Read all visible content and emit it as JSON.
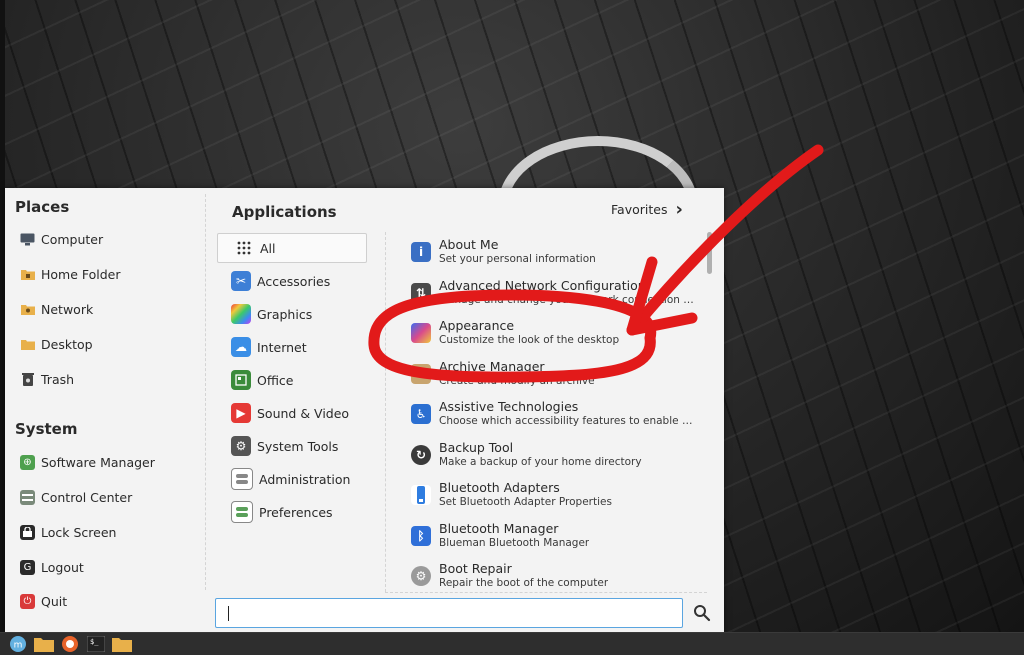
{
  "places": {
    "title": "Places",
    "items": [
      {
        "label": "Computer",
        "icon": "computer-icon"
      },
      {
        "label": "Home Folder",
        "icon": "home-folder-icon"
      },
      {
        "label": "Network",
        "icon": "network-folder-icon"
      },
      {
        "label": "Desktop",
        "icon": "desktop-folder-icon"
      },
      {
        "label": "Trash",
        "icon": "trash-icon"
      }
    ]
  },
  "system": {
    "title": "System",
    "items": [
      {
        "label": "Software Manager",
        "icon": "software-manager-icon"
      },
      {
        "label": "Control Center",
        "icon": "control-center-icon"
      },
      {
        "label": "Lock Screen",
        "icon": "lock-screen-icon"
      },
      {
        "label": "Logout",
        "icon": "logout-icon"
      },
      {
        "label": "Quit",
        "icon": "quit-icon"
      }
    ]
  },
  "applications": {
    "title": "Applications",
    "favorites_label": "Favorites",
    "categories": [
      {
        "label": "All",
        "icon": "grid-icon",
        "color": "#ffffff"
      },
      {
        "label": "Accessories",
        "icon": "scissors-icon",
        "color": "#3d7fd6"
      },
      {
        "label": "Graphics",
        "icon": "palette-icon",
        "color": "#c945c9"
      },
      {
        "label": "Internet",
        "icon": "cloud-icon",
        "color": "#3a8ee6"
      },
      {
        "label": "Office",
        "icon": "document-icon",
        "color": "#3b8b3b"
      },
      {
        "label": "Sound & Video",
        "icon": "play-icon",
        "color": "#e53935"
      },
      {
        "label": "System Tools",
        "icon": "gear-icon",
        "color": "#555555"
      },
      {
        "label": "Administration",
        "icon": "toggle-icon",
        "color": "#888888"
      },
      {
        "label": "Preferences",
        "icon": "toggle-icon",
        "color": "#5aa05a"
      }
    ],
    "apps": [
      {
        "name": "About Me",
        "description": "Set your personal information",
        "icon": "info-icon",
        "color": "#3a6fc4"
      },
      {
        "name": "Advanced Network Configuration",
        "description": "Manage and change your network connection sett...",
        "icon": "network-config-icon",
        "color": "#4a4a4a"
      },
      {
        "name": "Appearance",
        "description": "Customize the look of the desktop",
        "icon": "appearance-icon",
        "color": "#d94a8c"
      },
      {
        "name": "Archive Manager",
        "description": "Create and modify an archive",
        "icon": "archive-icon",
        "color": "#c8a46e"
      },
      {
        "name": "Assistive Technologies",
        "description": "Choose which accessibility features to enable whe...",
        "icon": "accessibility-icon",
        "color": "#2b6fd1"
      },
      {
        "name": "Backup Tool",
        "description": "Make a backup of your home directory",
        "icon": "backup-icon",
        "color": "#3a3a3a"
      },
      {
        "name": "Bluetooth Adapters",
        "description": "Set Bluetooth Adapter Properties",
        "icon": "bluetooth-adapter-icon",
        "color": "#2f7de0"
      },
      {
        "name": "Bluetooth Manager",
        "description": "Blueman Bluetooth Manager",
        "icon": "bluetooth-icon",
        "color": "#2f6fd8"
      },
      {
        "name": "Boot Repair",
        "description": "Repair the boot of the computer",
        "icon": "boot-repair-icon",
        "color": "#7a7a7a"
      }
    ]
  },
  "search": {
    "value": "",
    "placeholder": ""
  },
  "taskbar": {
    "items": [
      {
        "icon": "mint-menu-icon",
        "color": "#62b0e0"
      },
      {
        "icon": "files-icon",
        "color": "#e8b04a"
      },
      {
        "icon": "firefox-icon",
        "color": "#e8632a"
      },
      {
        "icon": "terminal-icon",
        "color": "#222222"
      },
      {
        "icon": "folder-icon",
        "color": "#e8b04a"
      }
    ]
  },
  "colors": {
    "annotation": "#e21a1a",
    "search_border": "#5aa5e0",
    "menu_bg": "#f3f3f3"
  }
}
